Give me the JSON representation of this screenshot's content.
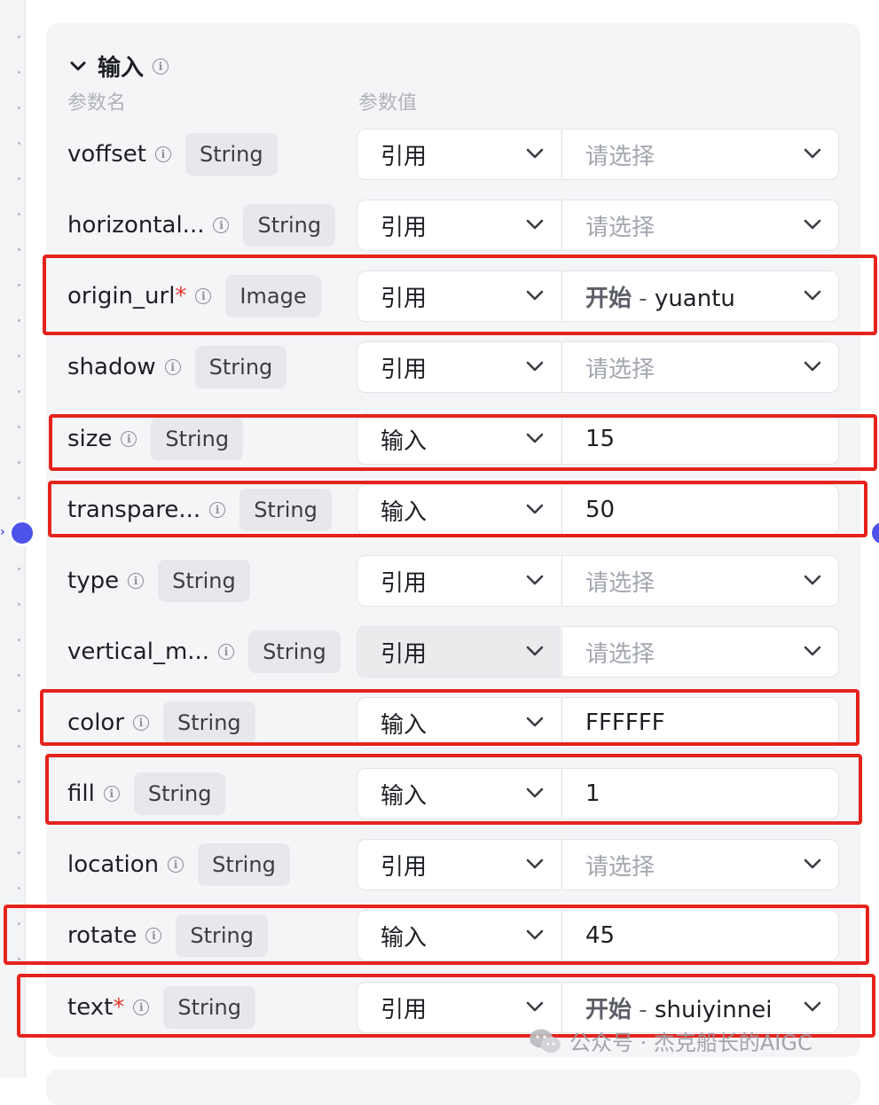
{
  "section": {
    "title": "输入",
    "col_name": "参数名",
    "col_value": "参数值"
  },
  "params": [
    {
      "name": "voffset",
      "required": false,
      "type": "String",
      "mode": "引用",
      "value": "请选择",
      "placeholder": true
    },
    {
      "name": "horizontal...",
      "required": false,
      "type": "String",
      "mode": "引用",
      "value": "请选择",
      "placeholder": true
    },
    {
      "name": "origin_url",
      "required": true,
      "type": "Image",
      "mode": "引用",
      "value_source": "开始",
      "value_sep": " - ",
      "value_var": "yuantu",
      "placeholder": false
    },
    {
      "name": "shadow",
      "required": false,
      "type": "String",
      "mode": "引用",
      "value": "请选择",
      "placeholder": true
    },
    {
      "name": "size",
      "required": false,
      "type": "String",
      "mode": "输入",
      "value": "15",
      "placeholder": false
    },
    {
      "name": "transpare...",
      "required": false,
      "type": "String",
      "mode": "输入",
      "value": "50",
      "placeholder": false
    },
    {
      "name": "type",
      "required": false,
      "type": "String",
      "mode": "引用",
      "value": "请选择",
      "placeholder": true
    },
    {
      "name": "vertical_m...",
      "required": false,
      "type": "String",
      "mode": "引用",
      "value": "请选择",
      "placeholder": true
    },
    {
      "name": "color",
      "required": false,
      "type": "String",
      "mode": "输入",
      "value": "FFFFFF",
      "placeholder": false
    },
    {
      "name": "fill",
      "required": false,
      "type": "String",
      "mode": "输入",
      "value": "1",
      "placeholder": false
    },
    {
      "name": "location",
      "required": false,
      "type": "String",
      "mode": "引用",
      "value": "请选择",
      "placeholder": true
    },
    {
      "name": "rotate",
      "required": false,
      "type": "String",
      "mode": "输入",
      "value": "45",
      "placeholder": false
    },
    {
      "name": "text",
      "required": true,
      "type": "String",
      "mode": "引用",
      "value_source": "开始",
      "value_sep": " - ",
      "value_var": "shuiyinnei",
      "placeholder": false
    }
  ],
  "required_mark": "*",
  "watermark": "公众号 · 杰克船长的AIGC",
  "colors": {
    "highlight": "#e5231c",
    "port": "#4d53e8",
    "required": "#e5372c"
  }
}
